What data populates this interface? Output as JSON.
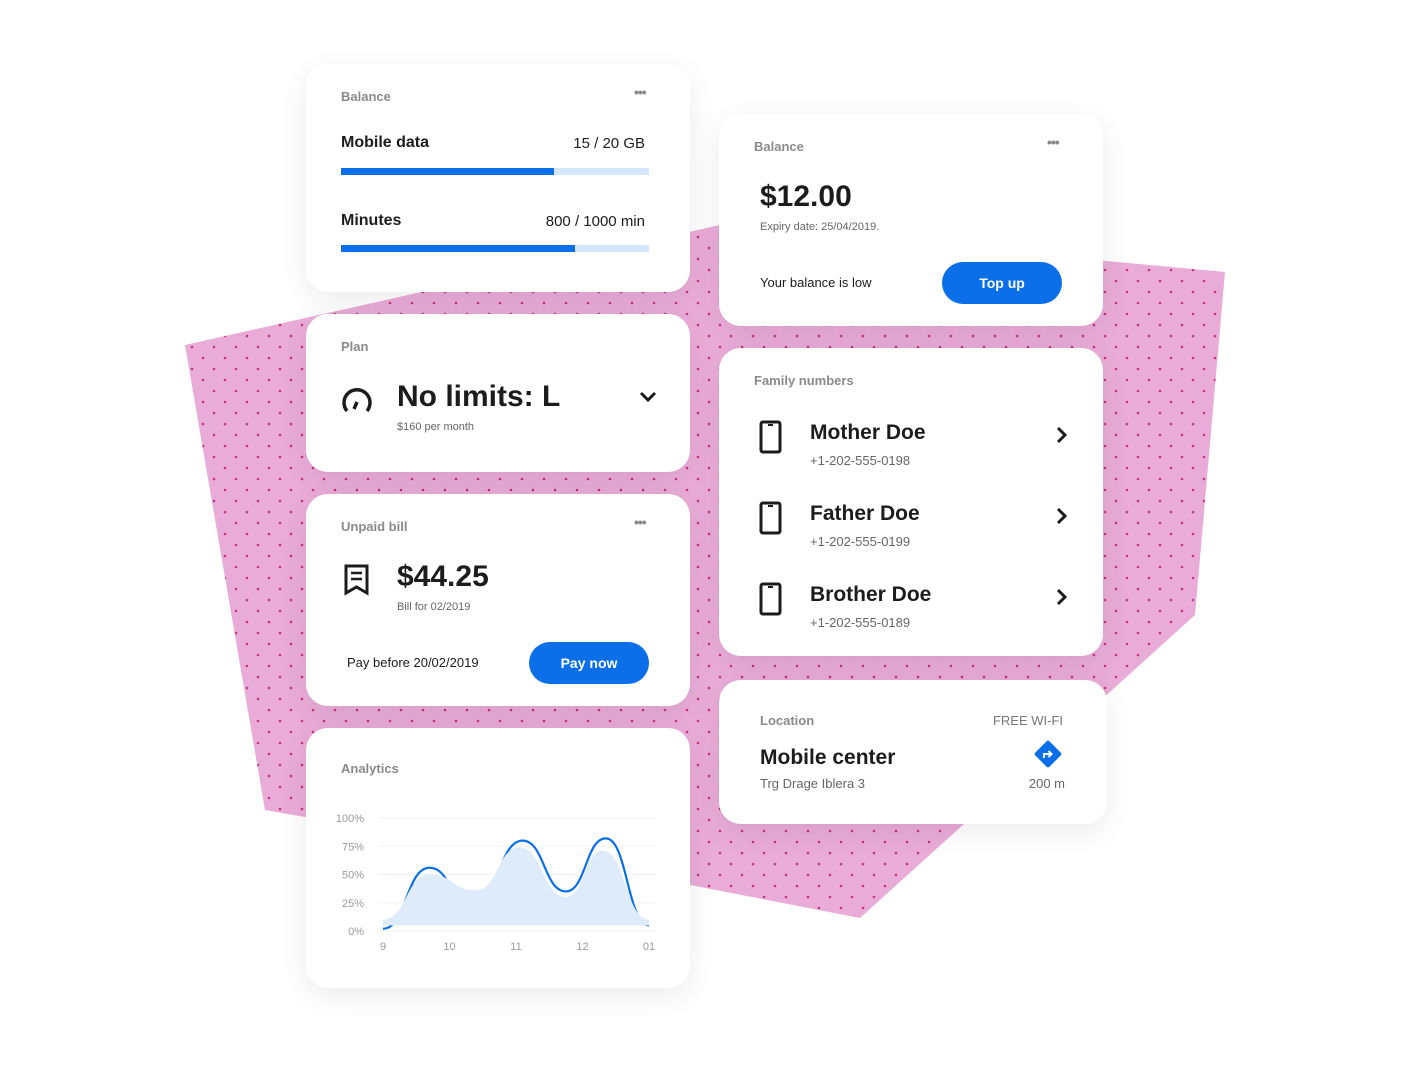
{
  "usage": {
    "title": "Balance",
    "data_label": "Mobile data",
    "data_value": "15 / 20 GB",
    "data_fraction": 0.69,
    "min_label": "Minutes",
    "min_value": "800 / 1000 min",
    "min_fraction": 0.76
  },
  "plan": {
    "title": "Plan",
    "name": "No limits: L",
    "price": "$160 per month"
  },
  "bill": {
    "title": "Unpaid bill",
    "amount": "$44.25",
    "period": "Bill for 02/2019",
    "due": "Pay before 20/02/2019",
    "button": "Pay now"
  },
  "balance": {
    "title": "Balance",
    "amount": "$12.00",
    "expiry": "Expiry date: 25/04/2019.",
    "status": "Your balance is low",
    "button": "Top up"
  },
  "family": {
    "title": "Family numbers",
    "items": [
      {
        "name": "Mother Doe",
        "phone": "+1-202-555-0198"
      },
      {
        "name": "Father Doe",
        "phone": "+1-202-555-0199"
      },
      {
        "name": "Brother Doe",
        "phone": "+1-202-555-0189"
      }
    ]
  },
  "location": {
    "title": "Location",
    "badge": "FREE WI-FI",
    "name": "Mobile center",
    "address": "Trg Drage Iblera 3",
    "distance": "200 m"
  },
  "analytics": {
    "title": "Analytics"
  },
  "colors": {
    "accent": "#0a6fe8",
    "background_shape": "#e9a9d6"
  },
  "chart_data": {
    "type": "line",
    "ylim": [
      0,
      100
    ],
    "yticks": [
      "100%",
      "75%",
      "50%",
      "25%",
      "0%"
    ],
    "xticks": [
      {
        "x": 9,
        "label": "9"
      },
      {
        "x": 10,
        "label": "10"
      },
      {
        "x": 11,
        "label": "11"
      },
      {
        "x": 12,
        "label": "12"
      },
      {
        "x": 13,
        "label": "01"
      }
    ],
    "grid": true,
    "series": [
      {
        "style": "line",
        "x": [
          9,
          9.7,
          10.35,
          11.1,
          11.75,
          12.35,
          13
        ],
        "y": [
          2,
          56,
          20,
          80,
          35,
          82,
          5
        ]
      },
      {
        "style": "area",
        "x": [
          9,
          9.7,
          10.4,
          11.05,
          11.75,
          12.3,
          13
        ],
        "y": [
          10,
          50,
          36,
          74,
          30,
          71,
          10
        ]
      }
    ]
  }
}
